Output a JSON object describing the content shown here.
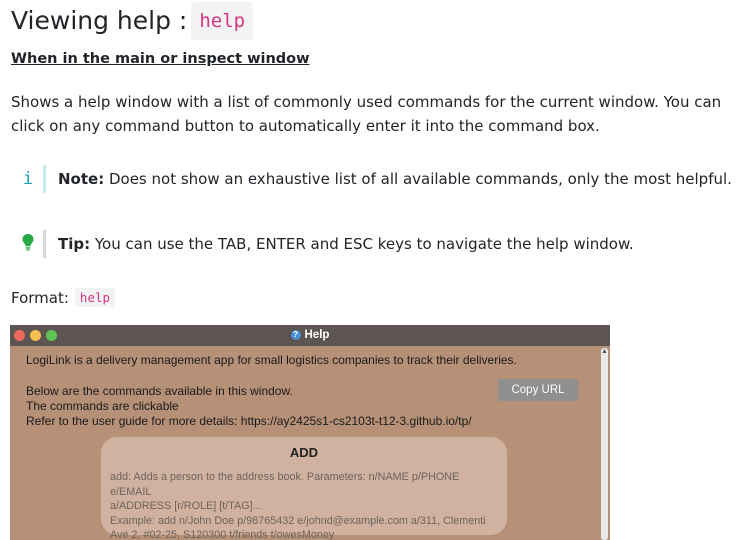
{
  "heading": {
    "text": "Viewing help :",
    "code": "help"
  },
  "subheading": "When in the main or inspect window",
  "description": "Shows a help window with a list of commonly used commands for the current window. You can click on any command button to automatically enter it into the command box.",
  "note": {
    "icon": "i",
    "label": "Note:",
    "text": " Does not show an exhaustive list of all available commands, only the most helpful."
  },
  "tip": {
    "label": "Tip:",
    "text": " You can use the TAB, ENTER and ESC keys to navigate the help window."
  },
  "format": {
    "label": "Format:",
    "code": "help"
  },
  "window": {
    "title": "Help",
    "intro": "LogiLink is a delivery management app for small logistics companies to track their deliveries.",
    "lines": [
      "Below are the commands available in this window.",
      "The commands are clickable",
      "Refer to the user guide for more details: https://ay2425s1-cs2103t-t12-3.github.io/tp/"
    ],
    "copy_button": "Copy URL",
    "command": {
      "title": "ADD",
      "desc_lines": [
        "add: Adds a person to the address book. Parameters: n/NAME p/PHONE e/EMAIL",
        "a/ADDRESS [r/ROLE] [t/TAG]...",
        "Example: add n/John Doe p/98765432 e/johnd@example.com a/311, Clementi",
        "Ave 2, #02-25, S120300 t/friends t/owesMoney"
      ]
    }
  },
  "colors": {
    "code_text": "#d63384",
    "note_icon": "#17a2b8",
    "tip_icon": "#28a745",
    "window_bg": "#b69077",
    "card_bg": "#d1b2a0"
  }
}
